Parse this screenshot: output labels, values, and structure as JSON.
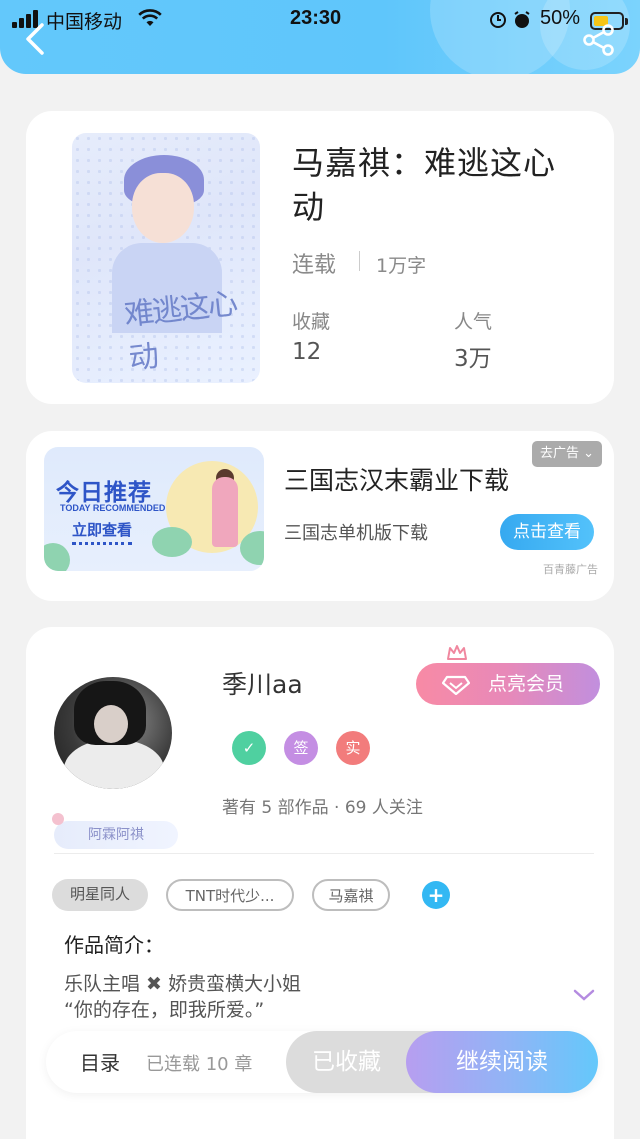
{
  "status_bar": {
    "carrier": "中国移动",
    "time": "23:30",
    "battery": "50%",
    "battery_level": 0.5
  },
  "header": {
    "back_icon": "chevron-left-icon",
    "share_icon": "share-icon"
  },
  "book": {
    "title": "马嘉祺：难逃这心动",
    "cover_text": "难逃这心动",
    "status": "连载",
    "word_count": "1万字",
    "favorites_label": "收藏",
    "favorites_value": "12",
    "popularity_label": "人气",
    "popularity_value": "3万"
  },
  "ad": {
    "image_title": "今日推荐",
    "image_subtitle": "TODAY RECOMMENDED",
    "image_button": "立即查看",
    "title": "三国志汉末霸业下载",
    "description": "三国志单机版下载",
    "close_label": "去广告 ⌄",
    "cta_label": "点击查看",
    "source": "百青藤广告"
  },
  "author": {
    "name": "季川aa",
    "vip_button": "点亮会员",
    "badges": [
      "✓",
      "签",
      "实"
    ],
    "meta": "著有 5 部作品 · 69 人关注",
    "fan_tag": "阿霖阿祺",
    "colors": {
      "badge_green": "#4fd0a0",
      "badge_purple": "#c48ee3",
      "badge_red": "#f27c7c"
    }
  },
  "tags": [
    "明星同人",
    "TNT时代少...",
    "马嘉祺"
  ],
  "intro": {
    "title": "作品简介：",
    "line1": "乐队主唱 ✖ 娇贵蛮横大小姐",
    "line2": "“你的存在，即我所爱。”"
  },
  "bottom_bar": {
    "toc_label": "目录",
    "chapter_count": "已连载 10 章",
    "favorite_label": "已收藏",
    "read_label": "继续阅读"
  }
}
